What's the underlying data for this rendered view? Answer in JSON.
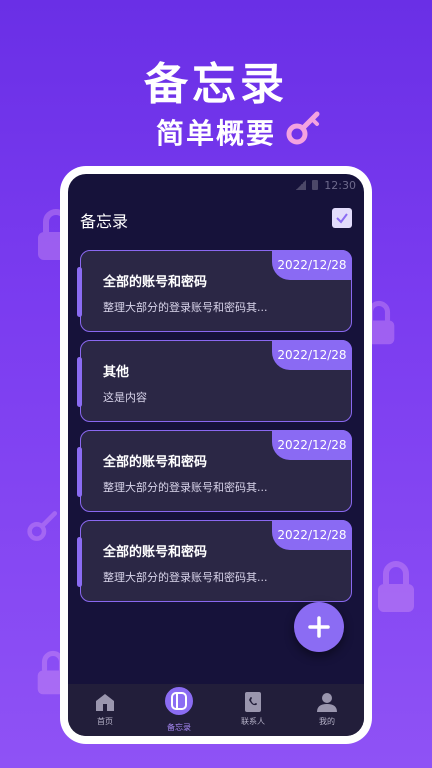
{
  "hero": {
    "title": "备忘录",
    "subtitle": "简单概要"
  },
  "status_bar": {
    "time": "12:30"
  },
  "app": {
    "title": "备忘录"
  },
  "notes": [
    {
      "title": "全部的账号和密码",
      "desc": "整理大部分的登录账号和密码其...",
      "date": "2022/12/28"
    },
    {
      "title": "其他",
      "desc": "这是内容",
      "date": "2022/12/28"
    },
    {
      "title": "全部的账号和密码",
      "desc": "整理大部分的登录账号和密码其...",
      "date": "2022/12/28"
    },
    {
      "title": "全部的账号和密码",
      "desc": "整理大部分的登录账号和密码其...",
      "date": "2022/12/28"
    }
  ],
  "tabs": [
    {
      "label": "首页",
      "icon": "home-icon",
      "active": false
    },
    {
      "label": "备忘录",
      "icon": "notebook-icon",
      "active": true
    },
    {
      "label": "联系人",
      "icon": "contacts-icon",
      "active": false
    },
    {
      "label": "我的",
      "icon": "user-icon",
      "active": false
    }
  ],
  "colors": {
    "background": "#7b3cf0",
    "screen": "#16123a",
    "accent": "#8b6cf3",
    "card": "#2b2745"
  }
}
